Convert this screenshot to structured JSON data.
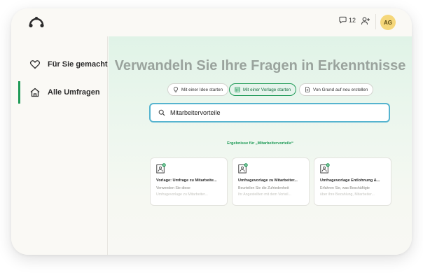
{
  "header": {
    "logo_icon": "cloud-logo-icon",
    "notification_count": "12",
    "avatar_initials": "AG",
    "avatar_color": "#f5d77a"
  },
  "sidebar": {
    "items": [
      {
        "label": "Für Sie gemacht",
        "icon": "heart-icon",
        "active": false
      },
      {
        "label": "Alle Umfragen",
        "icon": "home-icon",
        "active": true
      }
    ]
  },
  "main": {
    "headline": "Verwandeln Sie Ihre Fragen in Erkenntnisse",
    "chips": [
      {
        "label": "Mit einer Idee starten",
        "icon": "lightbulb-icon",
        "active": false
      },
      {
        "label": "Mit einer Vorlage starten",
        "icon": "template-grid-icon",
        "active": true
      },
      {
        "label": "Von Grund auf neu erstellen",
        "icon": "document-icon",
        "active": false
      }
    ],
    "search": {
      "value": "Mitarbeitervorteile",
      "icon": "search-icon"
    },
    "results_label": "Ergebnisse für „Mitarbeitervorteile“",
    "cards": [
      {
        "title": "Vorlage: Umfrage zu Mitarbeite...",
        "desc_line1": "Verwenden Sie diese",
        "desc_line2": "Umfragevorlage zu Mitarbeiter..."
      },
      {
        "title": "Umfragevorlage zu Mitarbeiter...",
        "desc_line1": "Beurteilen Sie die Zufriedenheit",
        "desc_line2": "Ihr Angestellten mit dem Vorteil..."
      },
      {
        "title": "Umfragevorlage Entlohnung &...",
        "desc_line1": "Erfahren Sie, was Beschäftigte",
        "desc_line2": "über ihre Bezahlung, Mitarbeiter..."
      }
    ]
  },
  "colors": {
    "accent_green": "#1f9a57",
    "search_border": "#56b4cf",
    "headline": "#9aa39d"
  }
}
